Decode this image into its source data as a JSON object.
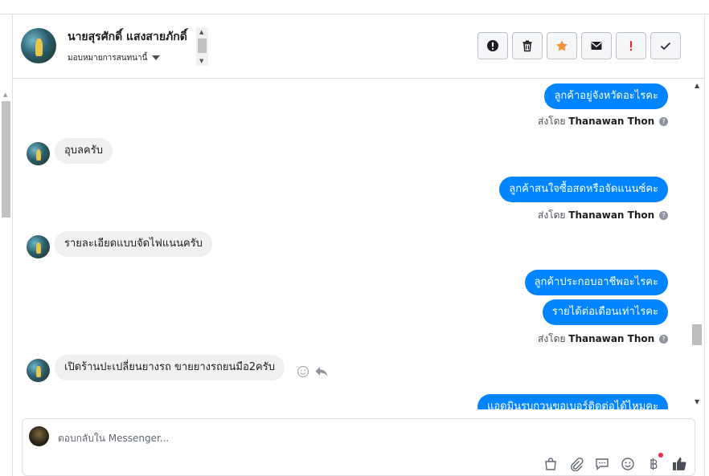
{
  "header": {
    "contact_name": "นายสุรศักดิ์ แสงสายภักดิ์",
    "assign_label": "มอบหมายการสนทนานี้"
  },
  "actions": [
    {
      "name": "report-button",
      "icon": "exclamation-circle-icon"
    },
    {
      "name": "delete-button",
      "icon": "trash-icon"
    },
    {
      "name": "star-button",
      "icon": "star-icon"
    },
    {
      "name": "mark-unread-button",
      "icon": "envelope-icon"
    },
    {
      "name": "follow-up-button",
      "icon": "exclamation-icon"
    },
    {
      "name": "mark-done-button",
      "icon": "check-icon"
    }
  ],
  "messages": {
    "m1": "ลูกค้าอยู่จังหวัดอะไรคะ",
    "sent1_prefix": "ส่งโดย",
    "sent1_name": "Thanawan Thon",
    "m2": "อุบลครับ",
    "m3": "ลูกค้าสนใจซื้อสดหรือจัดแนนซ์คะ",
    "sent2_prefix": "ส่งโดย",
    "sent2_name": "Thanawan Thon",
    "m4": "รายละเอียดแบบจัดไฟแนนครับ",
    "m5": "ลูกค้าประกอบอาชีพอะไรคะ",
    "m6": "รายได้ต่อเดือนเท่าไรคะ",
    "sent3_prefix": "ส่งโดย",
    "sent3_name": "Thanawan Thon",
    "m7": "เปิดร้านปะเปลี่ยนยางรถ ขายยางรถยนมือ2ครับ",
    "m8": "แอดมินรบกวนขอเบอร์ติดต่อได้ไหมคะ"
  },
  "composer": {
    "placeholder": "ตอบกลับใน Messenger..."
  },
  "colors": {
    "outgoing_bubble": "#0084ff",
    "incoming_bubble": "#f1f0f0",
    "star": "#f7923b",
    "follow_up": "#e4202e"
  }
}
